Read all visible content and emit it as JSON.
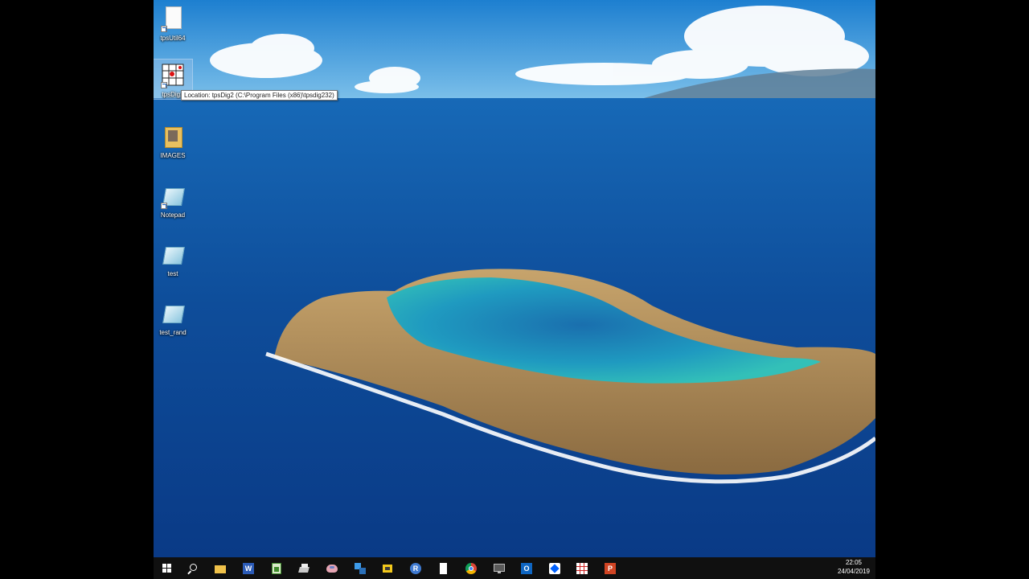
{
  "desktop": {
    "icons": [
      {
        "name": "tpsutil64",
        "label": "tpsUtil64",
        "icon": "blank-file-shortcut-icon"
      },
      {
        "name": "tpsdig2",
        "label": "tpsDig2",
        "icon": "tpsdig-grid-icon"
      },
      {
        "name": "images",
        "label": "IMAGES",
        "icon": "folder-icon"
      },
      {
        "name": "notepad",
        "label": "Notepad",
        "icon": "notepad-icon"
      },
      {
        "name": "test",
        "label": "test",
        "icon": "notepad-icon"
      },
      {
        "name": "test-rand",
        "label": "test_rand",
        "icon": "notepad-icon"
      }
    ],
    "tooltip": "Location: tpsDig2 (C:\\Program Files (x86)\\tpsdig232)"
  },
  "taskbar": {
    "buttons": [
      {
        "name": "start",
        "icon": "windows-logo-icon"
      },
      {
        "name": "search",
        "icon": "search-icon"
      },
      {
        "name": "file-explorer",
        "icon": "folder-icon"
      },
      {
        "name": "word",
        "icon": "word-icon"
      },
      {
        "name": "app-green",
        "icon": "spreadsheet-icon"
      },
      {
        "name": "app-gray",
        "icon": "printer-icon"
      },
      {
        "name": "app-brain",
        "icon": "brain-icon"
      },
      {
        "name": "app-blue",
        "icon": "network-icon"
      },
      {
        "name": "app-yellow",
        "icon": "puzzle-icon"
      },
      {
        "name": "app-r",
        "icon": "r-icon"
      },
      {
        "name": "blank-file",
        "icon": "blank-file-icon"
      },
      {
        "name": "chrome",
        "icon": "chrome-icon"
      },
      {
        "name": "monitor",
        "icon": "monitor-icon"
      },
      {
        "name": "outlook",
        "icon": "outlook-icon"
      },
      {
        "name": "dropbox",
        "icon": "dropbox-icon"
      },
      {
        "name": "tpsdig",
        "icon": "tpsdig-grid-icon"
      },
      {
        "name": "powerpoint",
        "icon": "powerpoint-icon"
      }
    ],
    "clock": {
      "time": "22:05",
      "date": "24/04/2019"
    }
  },
  "colors": {
    "sky_top": "#1f88d6",
    "ocean_deep": "#0b3f86",
    "lagoon": "#1e9cc0",
    "rock": "#b08a55",
    "taskbar": "#101010"
  }
}
